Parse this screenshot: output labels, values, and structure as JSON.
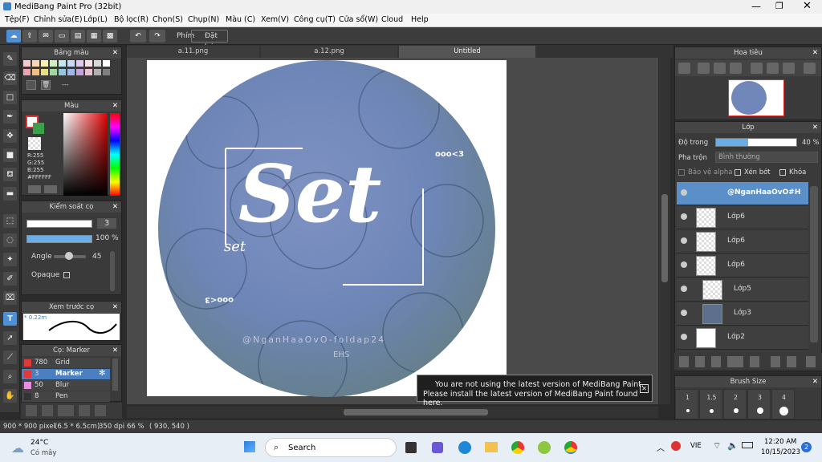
{
  "window": {
    "title": "MediBang Paint Pro (32bit)"
  },
  "menu": [
    "Tệp(F)",
    "Chỉnh sửa(E)",
    "Lớp(L)",
    "Bộ lọc(R)",
    "Chọn(S)",
    "Chụp(N)",
    "Màu (C)",
    "Xem(V)",
    "Công cụ(T)",
    "Cửa sổ(W)",
    "Cloud",
    "Help"
  ],
  "toolbar": {
    "key_label": "Phím",
    "reset_label": "Đặt lại"
  },
  "tabs": [
    "a.11.png",
    "a.12.png",
    "Untitled"
  ],
  "palette_panel": {
    "title": "Bảng màu",
    "extra": "---"
  },
  "color_panel": {
    "title": "Màu",
    "r": "R:255",
    "g": "G:255",
    "b": "B:255",
    "hex": "#FFFFFF"
  },
  "brush_control": {
    "title": "Kiểm soát cọ",
    "size": "3",
    "opacity": "100 %",
    "angle_label": "Angle",
    "angle_value": "45",
    "opaque_label": "Opaque"
  },
  "brush_preview": {
    "title": "Xem trước cọ",
    "size_label": "* 0.22m"
  },
  "brush_list": {
    "title": "Cọ: Marker",
    "items": [
      {
        "size": "780",
        "name": "Grid",
        "color": "#e0393b"
      },
      {
        "size": "3",
        "name": "Marker",
        "color": "#e0393b"
      },
      {
        "size": "50",
        "name": "Blur",
        "color": "#e68de0"
      },
      {
        "size": "8",
        "name": "Pen",
        "color": "#333333"
      }
    ]
  },
  "navigator": {
    "title": "Hoa tiêu"
  },
  "layers_panel": {
    "title": "Lớp",
    "opacity_label": "Độ trong",
    "opacity_value": "40 %",
    "opacity_level": 0.4,
    "blend_label": "Pha trộn",
    "blend_value": "Bình thường",
    "protect_alpha": "Bảo vệ alpha",
    "clip": "Xén bớt",
    "lock": "Khóa",
    "layers": [
      {
        "name": "@NganHaaOvO#H"
      },
      {
        "name": "Lớp6"
      },
      {
        "name": "Lớp6"
      },
      {
        "name": "Lớp6"
      },
      {
        "name": "Lớp5"
      },
      {
        "name": "Lớp3"
      },
      {
        "name": "Lớp2"
      }
    ]
  },
  "brush_size": {
    "title": "Brush Size",
    "sizes": [
      "1",
      "1.5",
      "2",
      "3",
      "4"
    ]
  },
  "canvas_art": {
    "title": "Set",
    "sub": "set",
    "tag1": "ooo<3",
    "tag2": "ooo<3",
    "watermark": "@NganHaaOvO-foldap24",
    "watermark2": "EHS"
  },
  "notice": {
    "line1": "You are not using the latest version of MediBang Paint.",
    "line2": "Please install the latest version of MediBang Paint found here."
  },
  "status": {
    "size": "900 * 900 pixel",
    "cm": "(6.5 * 6.5cm)",
    "dpi": "350 dpi",
    "zoom": "66 %",
    "coords": "( 930, 540 )"
  },
  "taskbar": {
    "weather_temp": "24°C",
    "weather_desc": "Có mây",
    "search": "Search",
    "lang": "VIE",
    "time": "12:20 AM",
    "date": "10/15/2023",
    "notif": "2"
  }
}
